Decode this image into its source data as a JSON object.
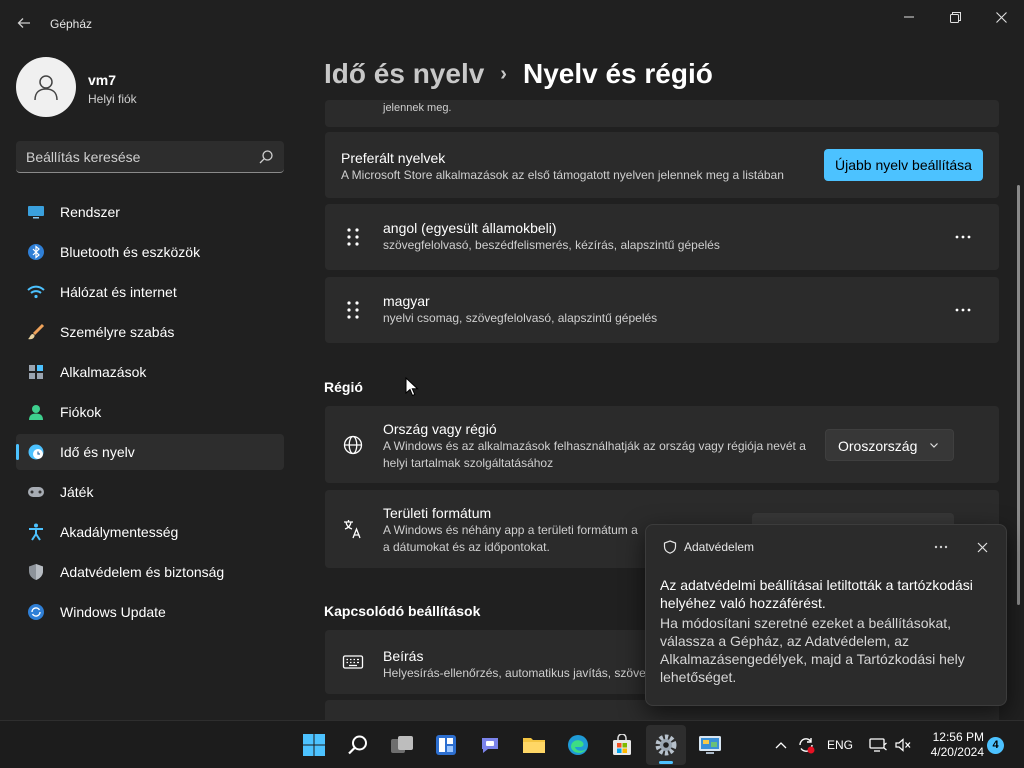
{
  "window": {
    "title": "Gépház"
  },
  "profile": {
    "name": "vm7",
    "account": "Helyi fiók"
  },
  "search": {
    "placeholder": "Beállítás keresése"
  },
  "nav": [
    {
      "label": "Rendszer",
      "icon": "monitor-icon"
    },
    {
      "label": "Bluetooth és eszközök",
      "icon": "bluetooth-icon"
    },
    {
      "label": "Hálózat és internet",
      "icon": "wifi-icon"
    },
    {
      "label": "Személyre szabás",
      "icon": "brush-icon"
    },
    {
      "label": "Alkalmazások",
      "icon": "apps-icon"
    },
    {
      "label": "Fiókok",
      "icon": "person-icon"
    },
    {
      "label": "Idő és nyelv",
      "icon": "clock-globe-icon",
      "active": true
    },
    {
      "label": "Játék",
      "icon": "gamepad-icon"
    },
    {
      "label": "Akadálymentesség",
      "icon": "accessibility-icon"
    },
    {
      "label": "Adatvédelem és biztonság",
      "icon": "shield-icon"
    },
    {
      "label": "Windows Update",
      "icon": "update-icon"
    }
  ],
  "breadcrumb": {
    "parent": "Idő és nyelv",
    "separator": "›",
    "current": "Nyelv és régió"
  },
  "top_cut_text": "jelennek meg.",
  "preferred": {
    "title": "Preferált nyelvek",
    "desc": "A Microsoft Store alkalmazások az első támogatott nyelven jelennek meg a listában",
    "button": "Újabb nyelv beállítása"
  },
  "languages": [
    {
      "name": "angol (egyesült államokbeli)",
      "features": "szövegfelolvasó, beszédfelismerés, kézírás, alapszintű gépelés"
    },
    {
      "name": "magyar",
      "features": "nyelvi csomag, szövegfelolvasó, alapszintű gépelés"
    }
  ],
  "region": {
    "heading": "Régió",
    "country": {
      "title": "Ország vagy régió",
      "desc1": "A Windows és az alkalmazások felhasználhatják az ország vagy régiója nevét a",
      "desc2": "helyi tartalmak szolgáltatásához",
      "value": "Oroszország"
    },
    "format": {
      "title": "Területi formátum",
      "desc1": "A Windows és néhány app a területi formátum a",
      "desc2": "a dátumokat és az időpontokat."
    }
  },
  "related": {
    "heading": "Kapcsolódó beállítások",
    "typing": {
      "title": "Beírás",
      "desc": "Helyesírás-ellenőrzés, automatikus javítás, szöveg"
    }
  },
  "toast": {
    "app": "Adatvédelem",
    "title": "Az adatvédelmi beállításai letiltották a tartózkodási helyéhez való hozzáférést.",
    "body": "Ha módosítani szeretné ezeket a beállításokat, válassza a Gépház, az Adatvédelem, az Alkalmazásengedélyek, majd a Tartózkodási hely lehetőséget."
  },
  "tray": {
    "language": "ENG",
    "time": "12:56 PM",
    "date": "4/20/2024",
    "notifications": "4"
  },
  "colors": {
    "accent": "#4cc2ff",
    "background": "#202020",
    "card": "#2b2b2b"
  }
}
